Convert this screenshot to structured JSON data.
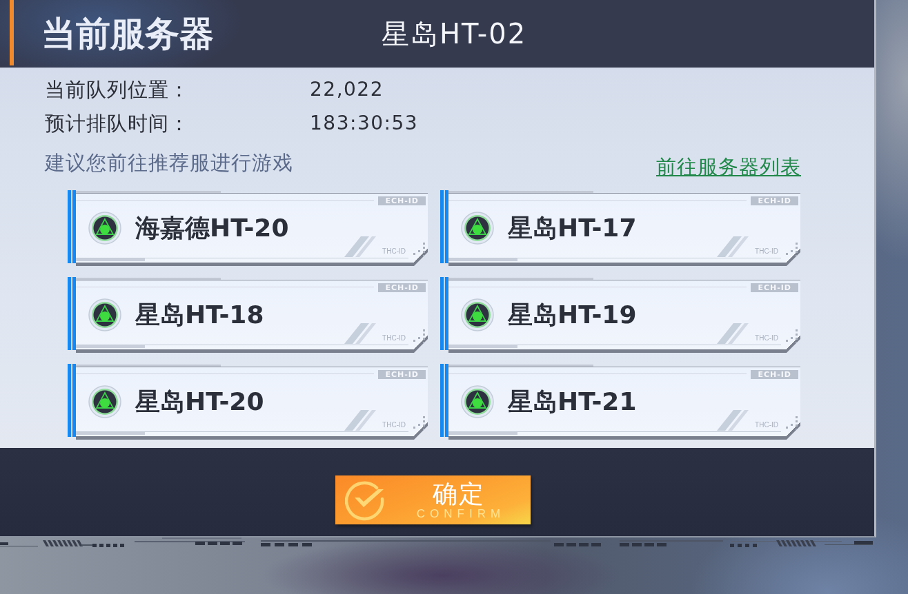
{
  "header": {
    "title": "当前服务器",
    "server_name": "星岛HT-02"
  },
  "queue_info": [
    {
      "label": "当前队列位置：",
      "value": "22,022"
    },
    {
      "label": "预计排队时间：",
      "value": "183:30:53"
    }
  ],
  "suggestion": "建议您前往推荐服进行游戏",
  "server_list_link": "前往服务器列表",
  "servers": [
    {
      "name": "海嘉德HT-20",
      "tag": "ECH-ID",
      "code": "THC-ID"
    },
    {
      "name": "星岛HT-17",
      "tag": "ECH-ID",
      "code": "THC-ID"
    },
    {
      "name": "星岛HT-18",
      "tag": "ECH-ID",
      "code": "THC-ID"
    },
    {
      "name": "星岛HT-19",
      "tag": "ECH-ID",
      "code": "THC-ID"
    },
    {
      "name": "星岛HT-20",
      "tag": "ECH-ID",
      "code": "THC-ID"
    },
    {
      "name": "星岛HT-21",
      "tag": "ECH-ID",
      "code": "THC-ID"
    }
  ],
  "confirm_button": {
    "label": "确定",
    "subtitle": "CONFIRM"
  }
}
